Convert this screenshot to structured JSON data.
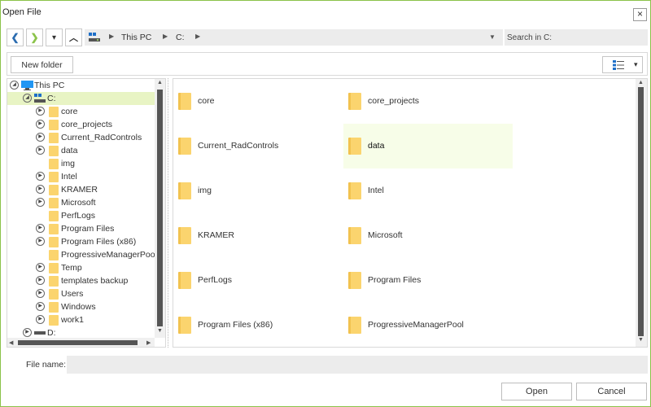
{
  "window": {
    "title": "Open File",
    "close_glyph": "×"
  },
  "nav": {
    "back_glyph": "❮",
    "forward_glyph": "❯",
    "dropdown_glyph": "▾",
    "up_glyph": "︿",
    "path_sep": "▶",
    "path_dropdown_glyph": "▼",
    "crumbs": [
      "This PC",
      "C:"
    ],
    "search_placeholder": "Search in C:"
  },
  "toolbar": {
    "new_folder_label": "New folder",
    "view_dropdown_glyph": "▾"
  },
  "tree": {
    "expander_collapsed": "▶",
    "expander_expanded": "◢",
    "root": "This PC",
    "drive_c": "C:",
    "folders": [
      "core",
      "core_projects",
      "Current_RadControls",
      "data",
      "img",
      "Intel",
      "KRAMER",
      "Microsoft",
      "PerfLogs",
      "Program Files",
      "Program Files (x86)",
      "ProgressiveManagerPool",
      "Temp",
      "templates backup",
      "Users",
      "Windows",
      "work1"
    ],
    "drive_d": "D:"
  },
  "files": {
    "items": [
      "core",
      "core_projects",
      "Current_RadControls",
      "data",
      "img",
      "Intel",
      "KRAMER",
      "Microsoft",
      "PerfLogs",
      "Program Files",
      "Program Files (x86)",
      "ProgressiveManagerPool"
    ]
  },
  "scroll": {
    "up": "▲",
    "down": "▼",
    "left": "◀",
    "right": "▶"
  },
  "footer": {
    "file_name_label": "File name:",
    "file_name_value": "",
    "open_label": "Open",
    "cancel_label": "Cancel"
  },
  "colors": {
    "accent_border": "#8bc34a",
    "selection": "#e8f4c4",
    "folder": "#fbd46e"
  }
}
